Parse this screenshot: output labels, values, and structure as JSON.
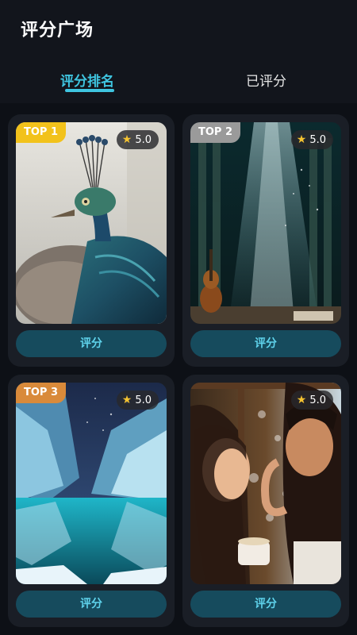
{
  "header": {
    "title": "评分广场"
  },
  "tabs": [
    {
      "label": "评分排名",
      "active": true
    },
    {
      "label": "已评分",
      "active": false
    }
  ],
  "colors": {
    "accent": "#3fc5e0",
    "background": "#0d1016",
    "card": "#1a1e26",
    "button": "#164b5d"
  },
  "cards": [
    {
      "badge": "TOP 1",
      "badge_color": "#f2c21b",
      "rating": "5.0",
      "button": "评分",
      "subject": "peacock"
    },
    {
      "badge": "TOP 2",
      "badge_color": "#9a9a9a",
      "rating": "5.0",
      "button": "评分",
      "subject": "violin on stage"
    },
    {
      "badge": "TOP 3",
      "badge_color": "#d98a3a",
      "rating": "5.0",
      "button": "评分",
      "subject": "ice cave"
    },
    {
      "badge": "",
      "badge_color": "",
      "rating": "5.0",
      "button": "评分",
      "subject": "couple by window"
    }
  ]
}
